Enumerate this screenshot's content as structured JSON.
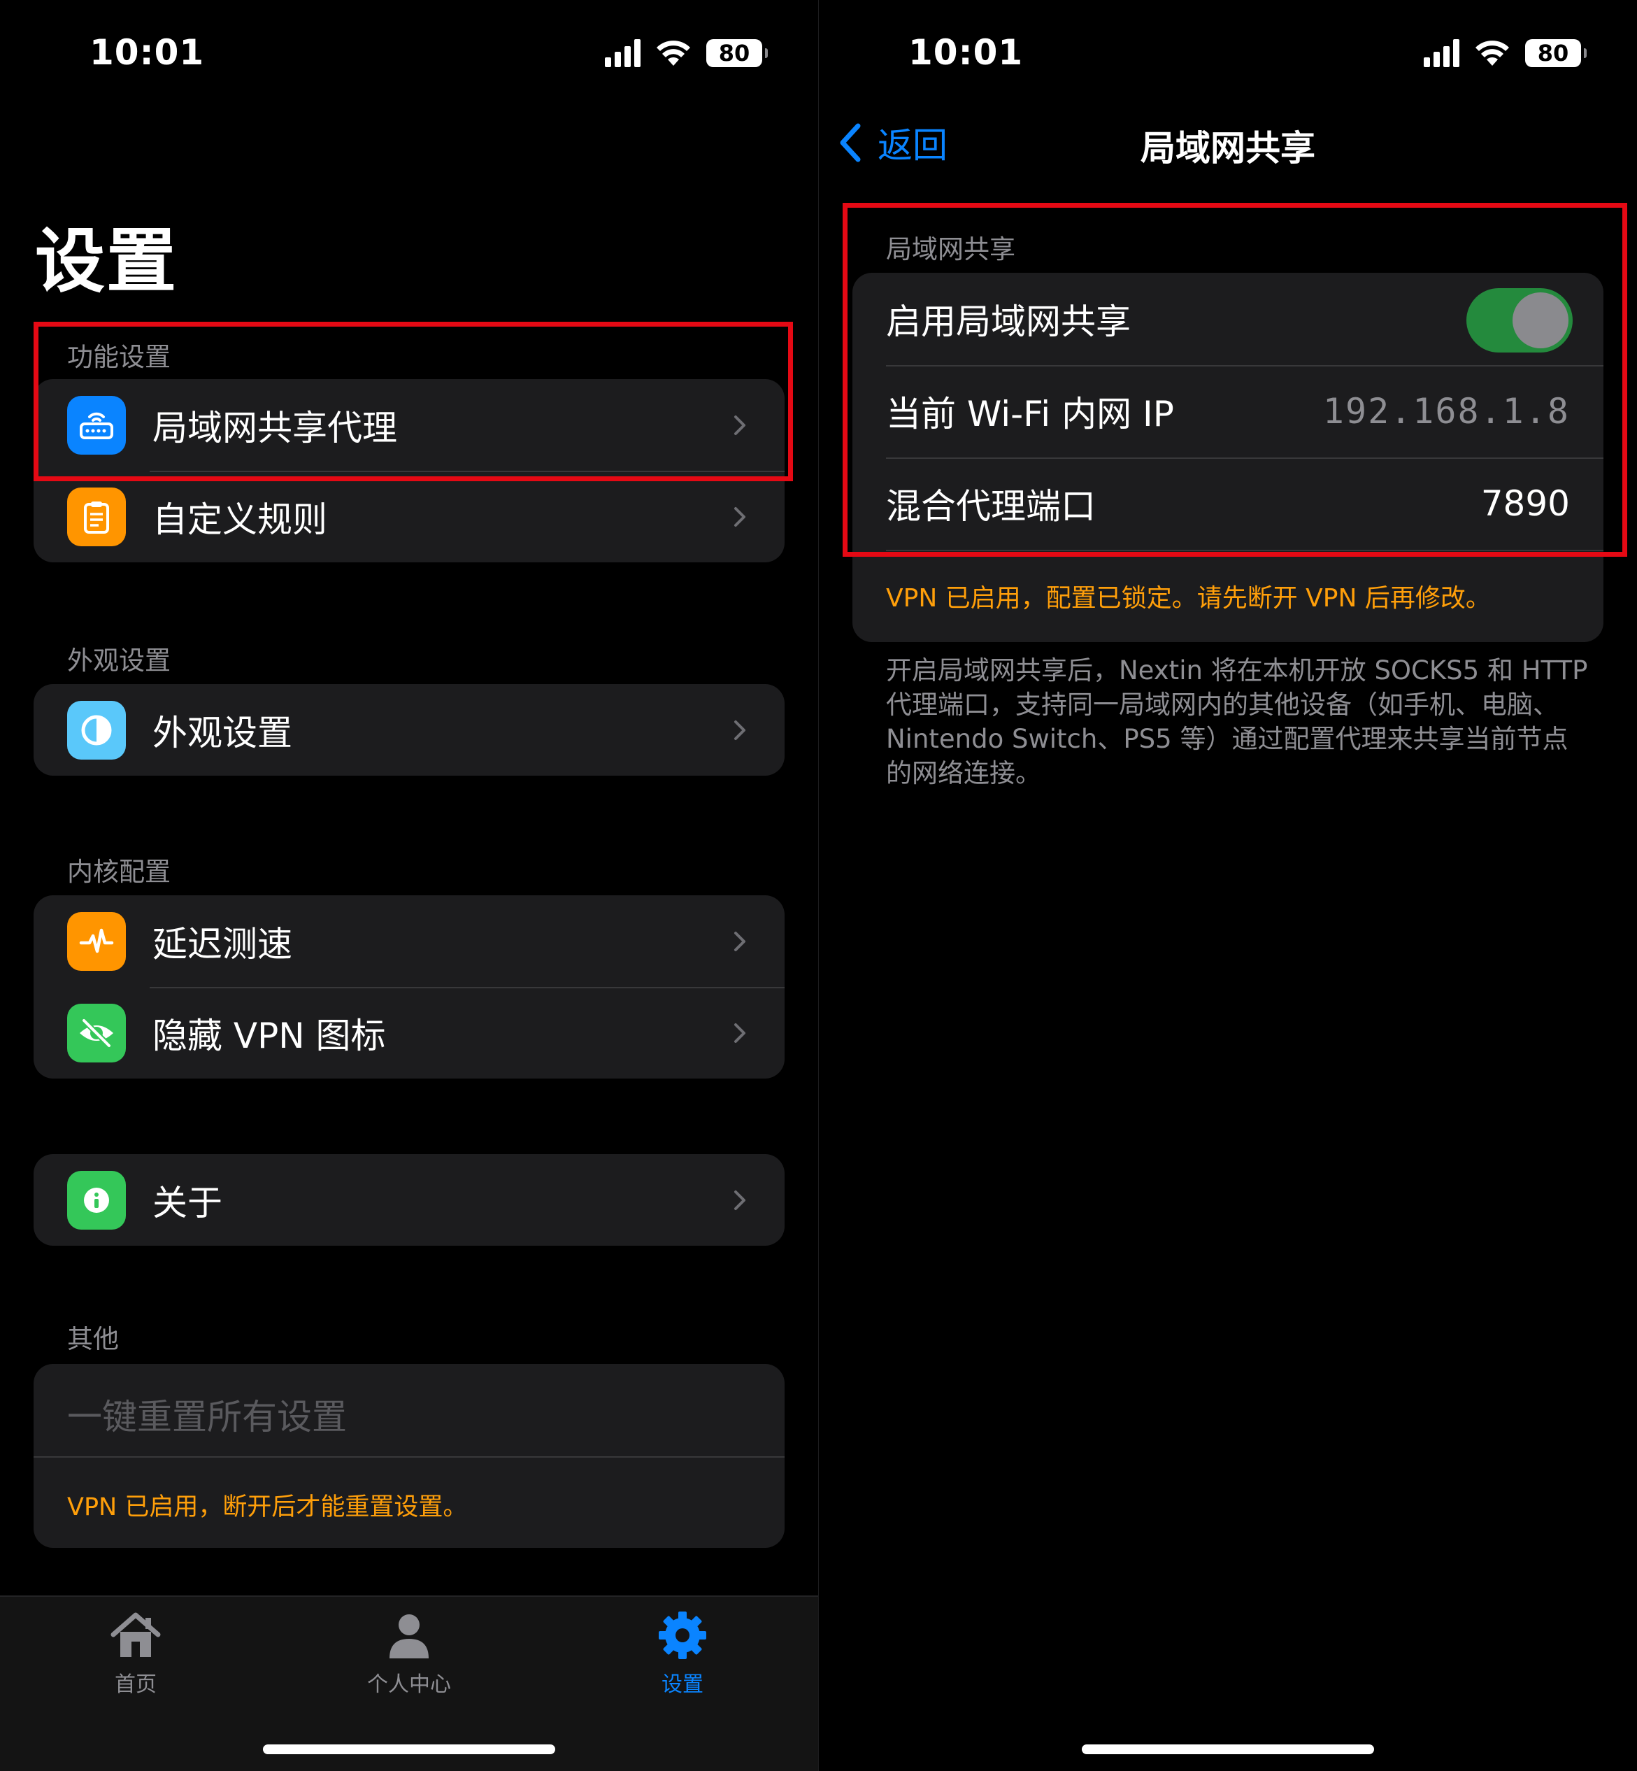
{
  "status": {
    "time": "10:01",
    "battery": "80"
  },
  "left": {
    "title": "设置",
    "sections": {
      "function": {
        "header": "功能设置",
        "items": [
          {
            "label": "局域网共享代理",
            "icon": "router-icon",
            "color": "#0a84ff"
          },
          {
            "label": "自定义规则",
            "icon": "clipboard-icon",
            "color": "#ff9500"
          }
        ]
      },
      "appearance": {
        "header": "外观设置",
        "items": [
          {
            "label": "外观设置",
            "icon": "contrast-icon",
            "color": "#5ac8fa"
          }
        ]
      },
      "core": {
        "header": "内核配置",
        "items": [
          {
            "label": "延迟测速",
            "icon": "pulse-icon",
            "color": "#ff9500"
          },
          {
            "label": "隐藏 VPN 图标",
            "icon": "eye-slash-icon",
            "color": "#34c759"
          }
        ]
      },
      "about": {
        "items": [
          {
            "label": "关于",
            "icon": "info-icon",
            "color": "#34c759"
          }
        ]
      },
      "other": {
        "header": "其他",
        "reset_label": "一键重置所有设置",
        "note": "VPN 已启用，断开后才能重置设置。"
      }
    },
    "tabbar": {
      "tabs": [
        {
          "label": "首页",
          "icon": "house-icon"
        },
        {
          "label": "个人中心",
          "icon": "person-icon"
        },
        {
          "label": "设置",
          "icon": "gear-icon",
          "active": true
        }
      ]
    }
  },
  "right": {
    "nav": {
      "back_label": "返回",
      "title": "局域网共享"
    },
    "section_header": "局域网共享",
    "rows": {
      "enable_label": "启用局域网共享",
      "enable_on": true,
      "wifi_ip_label": "当前 Wi-Fi 内网 IP",
      "wifi_ip_value": "192.168.1.8",
      "port_label": "混合代理端口",
      "port_value": "7890"
    },
    "note": "VPN 已启用，配置已锁定。请先断开 VPN 后再修改。",
    "footer": "开启局域网共享后，Nextin 将在本机开放 SOCKS5 和 HTTP 代理端口，支持同一局域网内的其他设备（如手机、电脑、Nintendo Switch、PS5 等）通过配置代理来共享当前节点的网络连接。"
  },
  "colors": {
    "accent": "#0a84ff",
    "warning": "#ff9f0a",
    "highlight": "#e50914",
    "toggle_on": "#248a3d"
  }
}
